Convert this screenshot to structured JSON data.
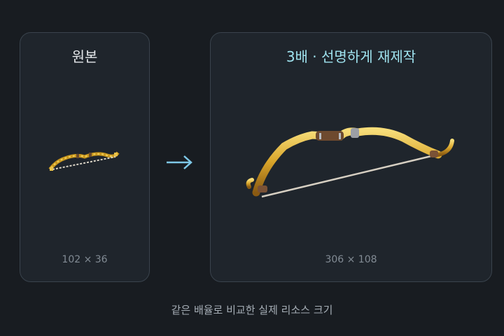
{
  "original_panel": {
    "title": "원본",
    "dimensions": "102 × 36"
  },
  "upscaled_panel": {
    "title": "3배 · 선명하게 재제작",
    "dimensions": "306 × 108"
  },
  "arrow_icon": "right-arrow-icon",
  "caption": "같은 배율로 비교한 실제 리소스 크기",
  "colors": {
    "background": "#181c21",
    "panel": "#1f252c",
    "accent": "#9fe3ef",
    "gold": "#d9a52a"
  }
}
